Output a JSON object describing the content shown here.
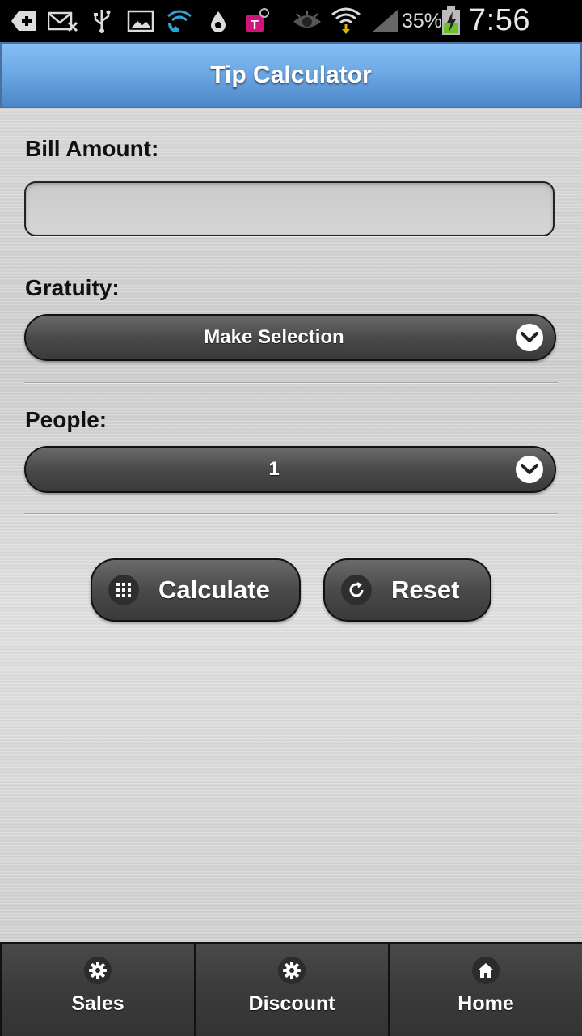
{
  "status_bar": {
    "battery_percent": "35%",
    "time": "7:56 AM",
    "icons": [
      "add-icon",
      "mail-error-icon",
      "usb-icon",
      "image-icon",
      "wifi-calling-icon",
      "water-drop-icon",
      "t-mobile-icon",
      "eye-icon",
      "wifi-icon",
      "signal-icon",
      "battery-charging-icon"
    ]
  },
  "header": {
    "title": "Tip Calculator"
  },
  "form": {
    "bill_amount_label": "Bill Amount:",
    "bill_amount_value": "",
    "gratuity_label": "Gratuity:",
    "gratuity_selected": "Make Selection",
    "people_label": "People:",
    "people_selected": "1"
  },
  "buttons": {
    "calculate_label": "Calculate",
    "reset_label": "Reset"
  },
  "bottom_nav": {
    "items": [
      {
        "label": "Sales",
        "icon": "gear-icon"
      },
      {
        "label": "Discount",
        "icon": "gear-icon"
      },
      {
        "label": "Home",
        "icon": "home-icon"
      }
    ]
  },
  "colors": {
    "header_blue": "#6aa6e2",
    "control_dark": "#4a4a4a",
    "text_dark": "#111111"
  }
}
